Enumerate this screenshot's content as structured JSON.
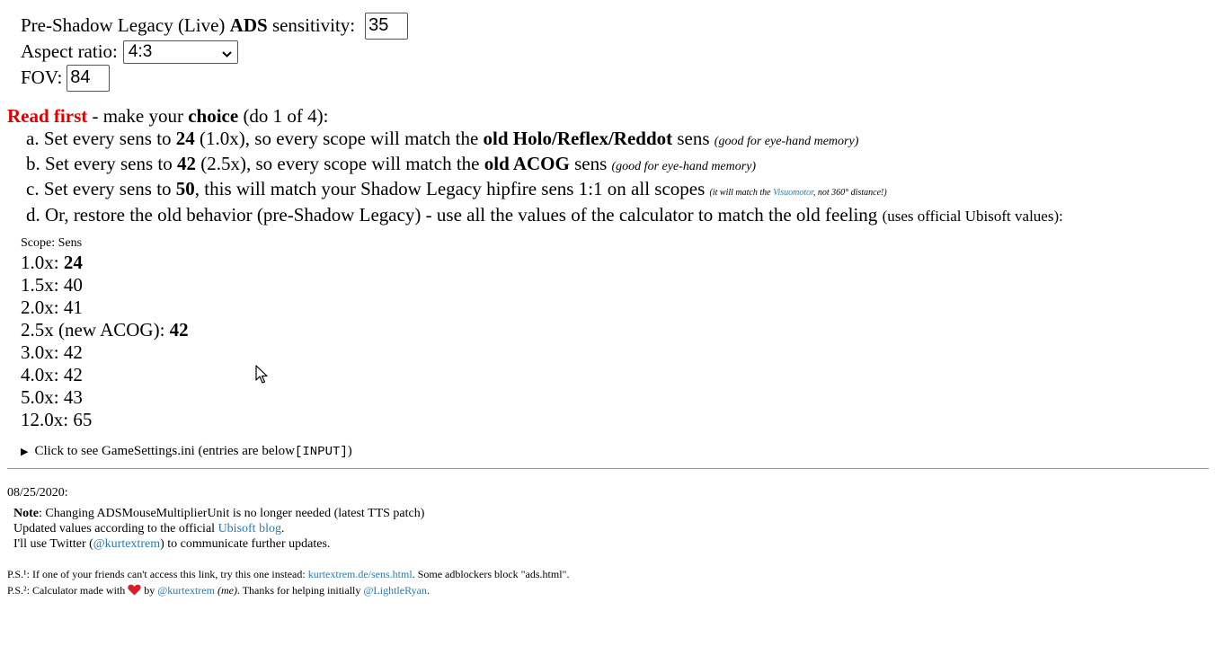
{
  "settings": {
    "sens_label_pre": "Pre-Shadow Legacy (Live) ",
    "sens_label_bold": "ADS",
    "sens_label_post": " sensitivity:",
    "sens_value": "35",
    "aspect_label": "Aspect ratio:",
    "aspect_selected": "4:3",
    "fov_label": "FOV:",
    "fov_value": "84"
  },
  "readfirst": {
    "red": "Read first",
    "mid": " - make your ",
    "bold": "choice",
    "end": " (do 1 of 4):"
  },
  "options": {
    "a": {
      "p1": "a. Set every sens to ",
      "b1": "24",
      "p2": " (1.0x), so every scope will match the ",
      "b2": "old Holo/Reflex/Reddot",
      "p3": " sens ",
      "note": "(good for eye-hand memory)"
    },
    "b": {
      "p1": "b. Set every sens to ",
      "b1": "42",
      "p2": " (2.5x), so every scope will match the ",
      "b2": "old ACOG",
      "p3": " sens ",
      "note": "(good for eye-hand memory)"
    },
    "c": {
      "p1": "c. Set every sens to ",
      "b1": "50",
      "p2": ", this will match your Shadow Legacy hipfire sens 1:1 on all scopes ",
      "note_pre": "(it will match the ",
      "note_link": "Visuomotor",
      "note_post": ", not 360° distance!)"
    },
    "d": {
      "p1": "d. Or, restore the old behavior (pre-Shadow Legacy) - use all the values of the calculator to match the old feeling ",
      "note": "(uses official Ubisoft values):"
    }
  },
  "scope_header": "Scope: Sens",
  "scopes": [
    {
      "label": "1.0x: ",
      "value": "24",
      "bold": true
    },
    {
      "label": "1.5x: ",
      "value": "40",
      "bold": false
    },
    {
      "label": "2.0x: ",
      "value": "41",
      "bold": false
    },
    {
      "label": "2.5x (new ACOG): ",
      "value": "42",
      "bold": true
    },
    {
      "label": "3.0x: ",
      "value": "42",
      "bold": false
    },
    {
      "label": "4.0x: ",
      "value": "42",
      "bold": false
    },
    {
      "label": "5.0x: ",
      "value": "43",
      "bold": false
    },
    {
      "label": "12.0x: ",
      "value": "65",
      "bold": false
    }
  ],
  "details": {
    "text": "Click to see GameSettings.ini (entries are below ",
    "code": "[INPUT]",
    "end": ")"
  },
  "date": "08/25/2020:",
  "notes": {
    "note_label": "Note",
    "note_text": ": Changing ADSMouseMultiplierUnit is no longer needed (latest TTS patch)",
    "updated_pre": "Updated values according to the official ",
    "updated_link": "Ubisoft blog",
    "updated_post": ".",
    "twitter_pre": "I'll use Twitter (",
    "twitter_link": "@kurtextrem",
    "twitter_post": ") to communicate further updates."
  },
  "ps": {
    "l1_pre": "P.S.¹: If one of your friends can't access this link, try this one instead: ",
    "l1_link": "kurtextrem.de/sens.html",
    "l1_post": ". Some adblockers block \"ads.html\".",
    "l2_pre": "P.S.²: Calculator made with ",
    "l2_by": " by ",
    "l2_link1": "@kurtextrem",
    "l2_me": " (me)",
    "l2_mid": ". Thanks for helping initially ",
    "l2_link2": "@LightleRyan",
    "l2_end": "."
  },
  "colors": {
    "red": "#e00000",
    "link": "#2a7ab0",
    "heart": "#d61f26"
  }
}
